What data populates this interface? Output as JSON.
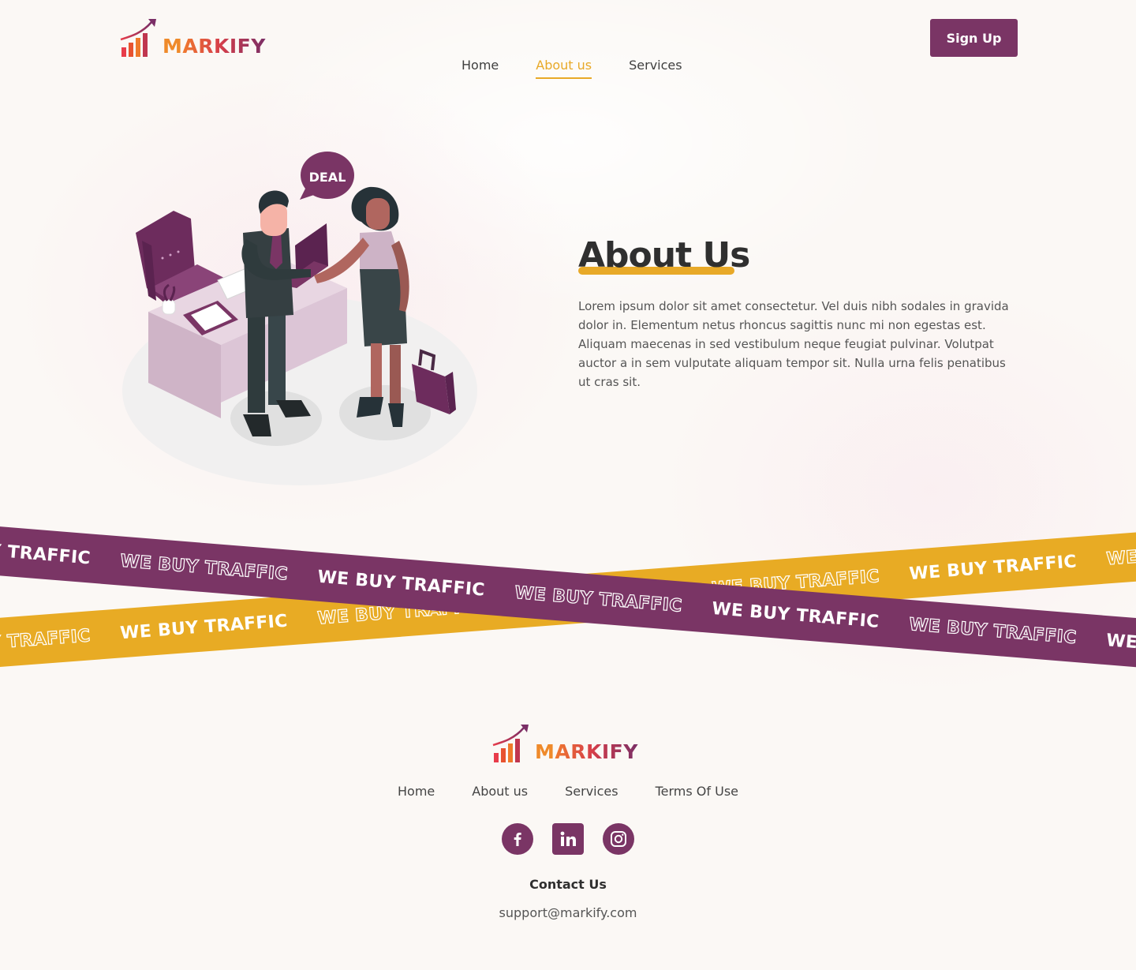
{
  "brand": {
    "name_first": "M",
    "name_rest": "ARKIFY",
    "colors": {
      "primary": "#7a3565",
      "accent": "#e8a928",
      "orange": "#ef8a2a",
      "red": "#d63e4a"
    }
  },
  "header": {
    "nav": [
      {
        "label": "Home",
        "active": false
      },
      {
        "label": "About us",
        "active": true
      },
      {
        "label": "Services",
        "active": false
      }
    ],
    "signup_label": "Sign Up"
  },
  "hero": {
    "illustration_badge": "DEAL",
    "title": "About Us",
    "body": "Lorem ipsum dolor sit amet consectetur. Vel duis nibh sodales in gravida dolor in. Elementum netus rhoncus sagittis nunc mi non egestas est. Aliquam maecenas in sed vestibulum neque feugiat pulvinar. Volutpat auctor a in sem vulputate aliquam tempor sit. Nulla urna felis penatibus ut cras sit."
  },
  "tapes": {
    "slogan": "WE BUY TRAFFIC"
  },
  "footer": {
    "nav": [
      "Home",
      "About us",
      "Services",
      "Terms Of Use"
    ],
    "socials": [
      "facebook-icon",
      "linkedin-icon",
      "instagram-icon"
    ],
    "contact_title": "Contact Us",
    "contact_email": "support@markify.com"
  }
}
